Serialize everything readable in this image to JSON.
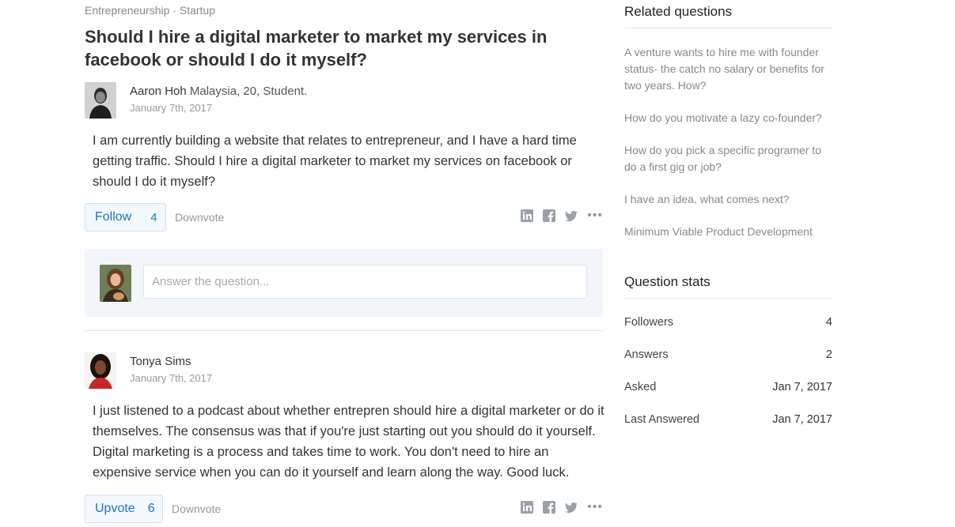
{
  "breadcrumb": {
    "topic1": "Entrepreneurship",
    "separator": "·",
    "topic2": "Startup"
  },
  "question": {
    "title": "Should I hire a digital marketer to market my services in facebook or should I do it myself?",
    "author_name": "Aaron Hoh",
    "author_bio": "Malaysia, 20, Student.",
    "date": "January 7th, 2017",
    "body": "I am currently building a website that relates to entrepreneur, and I have a hard time getting traffic. Should I hire a digital marketer to market my services on facebook or should I do it myself?",
    "follow_label": "Follow",
    "follow_count": "4",
    "downvote_label": "Downvote"
  },
  "answer_box": {
    "placeholder": "Answer the question..."
  },
  "answer": {
    "author_name": "Tonya Sims",
    "date": "January 7th, 2017",
    "body": "I just listened to a podcast about whether entrepren should hire a digital marketer or do it themselves. The consensus was that if you're just starting out you should do it yourself. Digital marketing is a process and takes time to work. You don't need to hire an expensive service when you can do it yourself and learn along the way. Good luck.",
    "upvote_label": "Upvote",
    "upvote_count": "6",
    "downvote_label": "Downvote"
  },
  "share_icons": [
    "linkedin-icon",
    "facebook-icon",
    "twitter-icon",
    "more-icon"
  ],
  "sidebar": {
    "related_title": "Related questions",
    "related": [
      "A venture wants to hire me with founder status- the catch no salary or benefits for two years. How?",
      "How do you motivate a lazy co-founder?",
      "How do you pick a specific programer to do a first gig or job?",
      "I have an idea, what comes next?",
      "Minimum Viable Product Development"
    ],
    "stats_title": "Question stats",
    "stats": [
      {
        "label": "Followers",
        "value": "4"
      },
      {
        "label": "Answers",
        "value": "2"
      },
      {
        "label": "Asked",
        "value": "Jan 7, 2017"
      },
      {
        "label": "Last Answered",
        "value": "Jan 7, 2017"
      }
    ]
  },
  "colors": {
    "accent": "#1a73c8",
    "muted": "#888888",
    "answer_bg": "#f2f5f9"
  }
}
